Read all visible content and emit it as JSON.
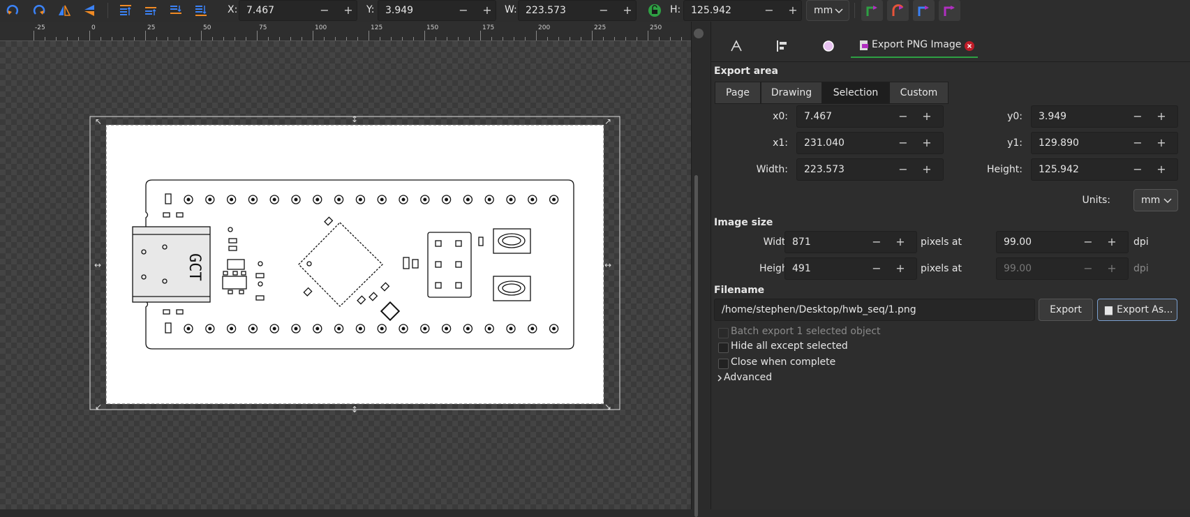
{
  "toolbar": {
    "x_label": "X:",
    "x_value": "7.467",
    "y_label": "Y:",
    "y_value": "3.949",
    "w_label": "W:",
    "w_value": "223.573",
    "h_label": "H:",
    "h_value": "125.942",
    "units": "mm",
    "minus": "−",
    "plus": "+"
  },
  "ruler": {
    "labels": [
      "-25",
      "0",
      "25",
      "50",
      "75",
      "100",
      "125",
      "150",
      "175",
      "200",
      "225",
      "250"
    ]
  },
  "canvas": {
    "board_silkscreen": "GCT"
  },
  "panel": {
    "tab_export_label": "Export PNG Image",
    "export_area_heading": "Export area",
    "area_buttons": [
      "Page",
      "Drawing",
      "Selection",
      "Custom"
    ],
    "active_area": "Selection",
    "x0_label": "x0:",
    "x0_value": "7.467",
    "y0_label": "y0:",
    "y0_value": "3.949",
    "x1_label": "x1:",
    "x1_value": "231.040",
    "y1_label": "y1:",
    "y1_value": "129.890",
    "width_label": "Width:",
    "width_value": "223.573",
    "height_label": "Height:",
    "height_value": "125.942",
    "units_label": "Units:",
    "units_value": "mm",
    "image_size_heading": "Image size",
    "img_width_label": "Width:",
    "img_width_value": "871",
    "img_height_label": "Height:",
    "img_height_value": "491",
    "pixels_at": "pixels at",
    "dpi_value": "99.00",
    "dpi_value_disabled": "99.00",
    "dpi_label": "dpi",
    "filename_heading": "Filename",
    "filename_value": "/home/stephen/Desktop/hwb_seq/1.png",
    "export_button": "Export",
    "export_as_button": "Export As...",
    "batch_label": "Batch export 1 selected object",
    "hide_label": "Hide all except selected",
    "close_label": "Close when complete",
    "advanced_label": "Advanced"
  },
  "colors": {
    "accent_green": "#2ea043",
    "accent_purple": "#b02fc0",
    "toolbar_bg": "#2d2d2d"
  }
}
